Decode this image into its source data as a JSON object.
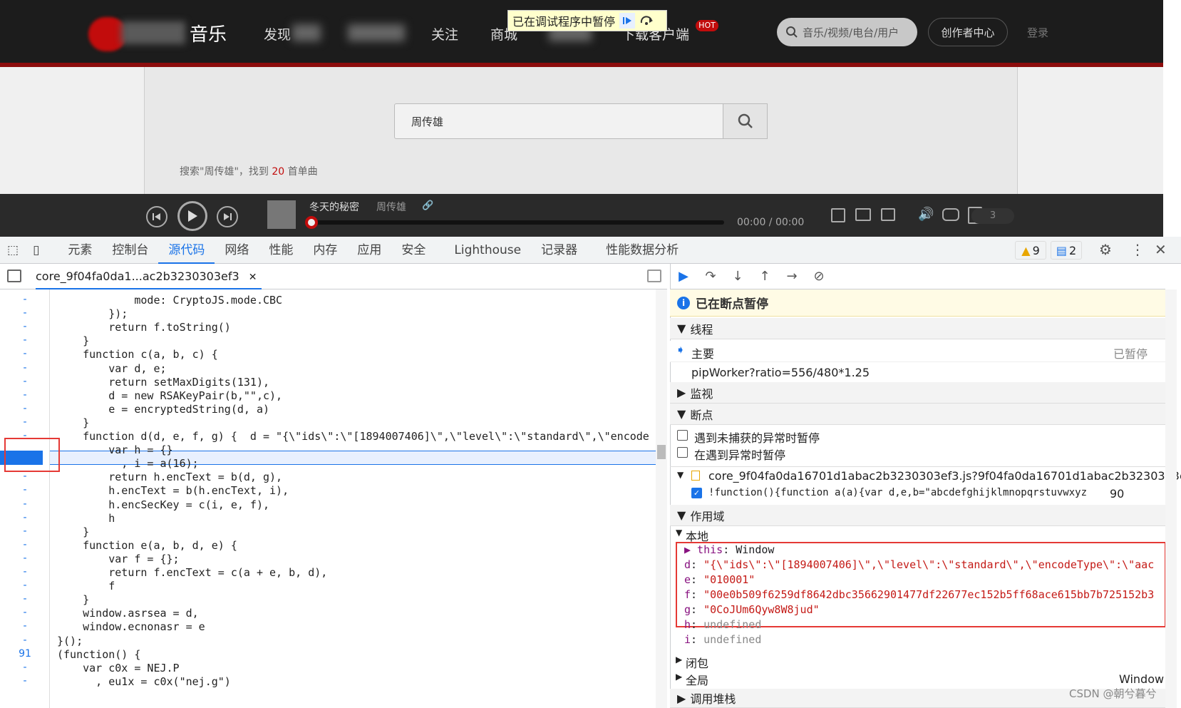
{
  "site": {
    "logo_text": "音乐",
    "nav": [
      "发现",
      "关注",
      "商城",
      "下载客户端"
    ],
    "hot_badge": "HOT",
    "search_placeholder": "音乐/视频/电台/用户",
    "creator_label": "创作者中心",
    "login_label": "登录",
    "debugger_banner": "已在调试程序中暂停",
    "search_value": "周传雄",
    "result_prefix": "搜索\"周传雄\"，找到",
    "result_count": "20",
    "result_suffix": "首单曲",
    "player": {
      "song": "冬天的秘密",
      "artist": "周传雄",
      "time": "00:00 / 00:00",
      "count": "3"
    }
  },
  "devtools": {
    "tabs": [
      "元素",
      "控制台",
      "源代码",
      "网络",
      "性能",
      "内存",
      "应用",
      "安全",
      "Lighthouse",
      "记录器",
      "性能数据分析"
    ],
    "active_tab": "源代码",
    "warnings": "9",
    "messages": "2",
    "file_tab": "core_9f04fa0da1...ac2b3230303ef3",
    "paused_title": "已在断点暂停",
    "threads_label": "线程",
    "thread_main": "主要",
    "thread_main_status": "已暂停",
    "thread_worker": "pipWorker?ratio=556/480*1.25",
    "watch_label": "监视",
    "breakpoints_label": "断点",
    "bp_uncaught": "遇到未捕获的异常时暂停",
    "bp_caught": "在遇到异常时暂停",
    "bp_file": "core_9f04fa0da16701d1abac2b3230303ef3.js?9f04fa0da16701d1abac2b3230303ef...",
    "bp_code": "!function(){function a(a){var d,e,b=\"abcdefghijklmnopqrstuvwxyz...",
    "bp_line": "90",
    "scope_label": "作用域",
    "local_label": "本地",
    "scope_vars": [
      {
        "k": "this",
        "v": "Window"
      },
      {
        "k": "d",
        "v": "\"{\\\"ids\\\":\\\"[1894007406]\\\",\\\"level\\\":\\\"standard\\\",\\\"encodeType\\\":\\\"aac"
      },
      {
        "k": "e",
        "v": "\"010001\""
      },
      {
        "k": "f",
        "v": "\"00e0b509f6259df8642dbc35662901477df22677ec152b5ff68ace615bb7b725152b3"
      },
      {
        "k": "g",
        "v": "\"0CoJUm6Qyw8W8jud\""
      },
      {
        "k": "h",
        "v": "undefined"
      },
      {
        "k": "i",
        "v": "undefined"
      }
    ],
    "closure_label": "闭包",
    "global_label": "全局",
    "global_value": "Window",
    "callstack_label": "调用堆栈",
    "watermark": "CSDN @朝兮暮兮"
  },
  "code": {
    "lines": [
      {
        "g": "-",
        "t": "            mode: CryptoJS.mode.CBC"
      },
      {
        "g": "-",
        "t": "        });"
      },
      {
        "g": "-",
        "t": "        return f.toString()"
      },
      {
        "g": "-",
        "t": "    }"
      },
      {
        "g": "-",
        "t": "    function c(a, b, c) {"
      },
      {
        "g": "-",
        "t": "        var d, e;"
      },
      {
        "g": "-",
        "t": "        return setMaxDigits(131),"
      },
      {
        "g": "-",
        "t": "        d = new RSAKeyPair(b,\"\",c),"
      },
      {
        "g": "-",
        "t": "        e = encryptedString(d, a)"
      },
      {
        "g": "-",
        "t": "    }"
      },
      {
        "g": "-",
        "t": "    function d(d, e, f, g) {  d = \"{\\\"ids\\\":\\\"[1894007406]\\\",\\\"level\\\":\\\"standard\\\",\\\"encode"
      },
      {
        "g": "-",
        "t": "        var h = {}"
      },
      {
        "g": "-",
        "t": "          , i = a(16);"
      },
      {
        "g": "-",
        "t": "        return h.encText = b(d, g),"
      },
      {
        "g": "-",
        "t": "        h.encText = b(h.encText, i),"
      },
      {
        "g": "-",
        "t": "        h.encSecKey = c(i, e, f),"
      },
      {
        "g": "-",
        "t": "        h"
      },
      {
        "g": "-",
        "t": "    }"
      },
      {
        "g": "-",
        "t": "    function e(a, b, d, e) {"
      },
      {
        "g": "-",
        "t": "        var f = {};"
      },
      {
        "g": "-",
        "t": "        return f.encText = c(a + e, b, d),"
      },
      {
        "g": "-",
        "t": "        f"
      },
      {
        "g": "-",
        "t": "    }"
      },
      {
        "g": "-",
        "t": "    window.asrsea = d,"
      },
      {
        "g": "-",
        "t": "    window.ecnonasr = e"
      },
      {
        "g": "-",
        "t": "}();"
      },
      {
        "g": "91",
        "t": "(function() {"
      },
      {
        "g": "-",
        "t": "    var c0x = NEJ.P"
      },
      {
        "g": "-",
        "t": "      , eu1x = c0x(\"nej.g\")"
      }
    ]
  }
}
